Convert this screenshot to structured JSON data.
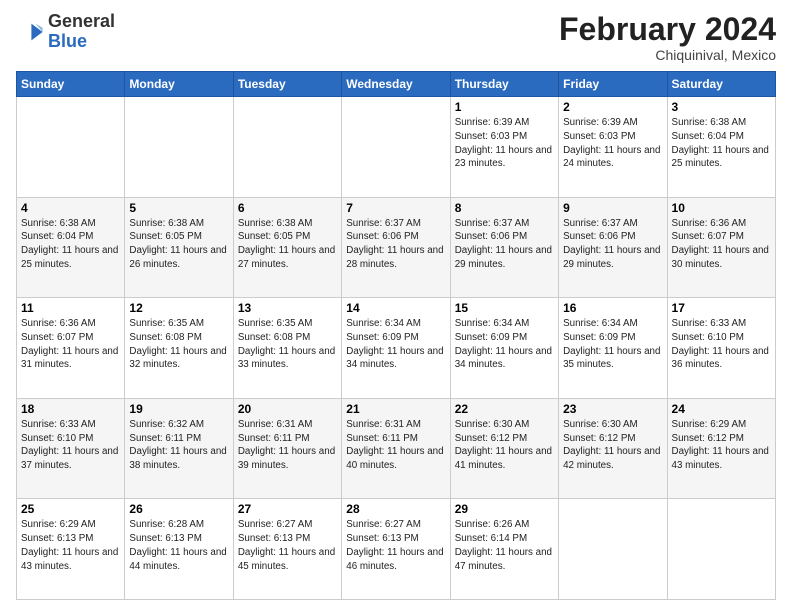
{
  "header": {
    "logo_general": "General",
    "logo_blue": "Blue",
    "title": "February 2024",
    "subtitle": "Chiquinival, Mexico"
  },
  "weekdays": [
    "Sunday",
    "Monday",
    "Tuesday",
    "Wednesday",
    "Thursday",
    "Friday",
    "Saturday"
  ],
  "weeks": [
    [
      {
        "day": "",
        "info": ""
      },
      {
        "day": "",
        "info": ""
      },
      {
        "day": "",
        "info": ""
      },
      {
        "day": "",
        "info": ""
      },
      {
        "day": "1",
        "info": "Sunrise: 6:39 AM\nSunset: 6:03 PM\nDaylight: 11 hours and 23 minutes."
      },
      {
        "day": "2",
        "info": "Sunrise: 6:39 AM\nSunset: 6:03 PM\nDaylight: 11 hours and 24 minutes."
      },
      {
        "day": "3",
        "info": "Sunrise: 6:38 AM\nSunset: 6:04 PM\nDaylight: 11 hours and 25 minutes."
      }
    ],
    [
      {
        "day": "4",
        "info": "Sunrise: 6:38 AM\nSunset: 6:04 PM\nDaylight: 11 hours and 25 minutes."
      },
      {
        "day": "5",
        "info": "Sunrise: 6:38 AM\nSunset: 6:05 PM\nDaylight: 11 hours and 26 minutes."
      },
      {
        "day": "6",
        "info": "Sunrise: 6:38 AM\nSunset: 6:05 PM\nDaylight: 11 hours and 27 minutes."
      },
      {
        "day": "7",
        "info": "Sunrise: 6:37 AM\nSunset: 6:06 PM\nDaylight: 11 hours and 28 minutes."
      },
      {
        "day": "8",
        "info": "Sunrise: 6:37 AM\nSunset: 6:06 PM\nDaylight: 11 hours and 29 minutes."
      },
      {
        "day": "9",
        "info": "Sunrise: 6:37 AM\nSunset: 6:06 PM\nDaylight: 11 hours and 29 minutes."
      },
      {
        "day": "10",
        "info": "Sunrise: 6:36 AM\nSunset: 6:07 PM\nDaylight: 11 hours and 30 minutes."
      }
    ],
    [
      {
        "day": "11",
        "info": "Sunrise: 6:36 AM\nSunset: 6:07 PM\nDaylight: 11 hours and 31 minutes."
      },
      {
        "day": "12",
        "info": "Sunrise: 6:35 AM\nSunset: 6:08 PM\nDaylight: 11 hours and 32 minutes."
      },
      {
        "day": "13",
        "info": "Sunrise: 6:35 AM\nSunset: 6:08 PM\nDaylight: 11 hours and 33 minutes."
      },
      {
        "day": "14",
        "info": "Sunrise: 6:34 AM\nSunset: 6:09 PM\nDaylight: 11 hours and 34 minutes."
      },
      {
        "day": "15",
        "info": "Sunrise: 6:34 AM\nSunset: 6:09 PM\nDaylight: 11 hours and 34 minutes."
      },
      {
        "day": "16",
        "info": "Sunrise: 6:34 AM\nSunset: 6:09 PM\nDaylight: 11 hours and 35 minutes."
      },
      {
        "day": "17",
        "info": "Sunrise: 6:33 AM\nSunset: 6:10 PM\nDaylight: 11 hours and 36 minutes."
      }
    ],
    [
      {
        "day": "18",
        "info": "Sunrise: 6:33 AM\nSunset: 6:10 PM\nDaylight: 11 hours and 37 minutes."
      },
      {
        "day": "19",
        "info": "Sunrise: 6:32 AM\nSunset: 6:11 PM\nDaylight: 11 hours and 38 minutes."
      },
      {
        "day": "20",
        "info": "Sunrise: 6:31 AM\nSunset: 6:11 PM\nDaylight: 11 hours and 39 minutes."
      },
      {
        "day": "21",
        "info": "Sunrise: 6:31 AM\nSunset: 6:11 PM\nDaylight: 11 hours and 40 minutes."
      },
      {
        "day": "22",
        "info": "Sunrise: 6:30 AM\nSunset: 6:12 PM\nDaylight: 11 hours and 41 minutes."
      },
      {
        "day": "23",
        "info": "Sunrise: 6:30 AM\nSunset: 6:12 PM\nDaylight: 11 hours and 42 minutes."
      },
      {
        "day": "24",
        "info": "Sunrise: 6:29 AM\nSunset: 6:12 PM\nDaylight: 11 hours and 43 minutes."
      }
    ],
    [
      {
        "day": "25",
        "info": "Sunrise: 6:29 AM\nSunset: 6:13 PM\nDaylight: 11 hours and 43 minutes."
      },
      {
        "day": "26",
        "info": "Sunrise: 6:28 AM\nSunset: 6:13 PM\nDaylight: 11 hours and 44 minutes."
      },
      {
        "day": "27",
        "info": "Sunrise: 6:27 AM\nSunset: 6:13 PM\nDaylight: 11 hours and 45 minutes."
      },
      {
        "day": "28",
        "info": "Sunrise: 6:27 AM\nSunset: 6:13 PM\nDaylight: 11 hours and 46 minutes."
      },
      {
        "day": "29",
        "info": "Sunrise: 6:26 AM\nSunset: 6:14 PM\nDaylight: 11 hours and 47 minutes."
      },
      {
        "day": "",
        "info": ""
      },
      {
        "day": "",
        "info": ""
      }
    ]
  ]
}
